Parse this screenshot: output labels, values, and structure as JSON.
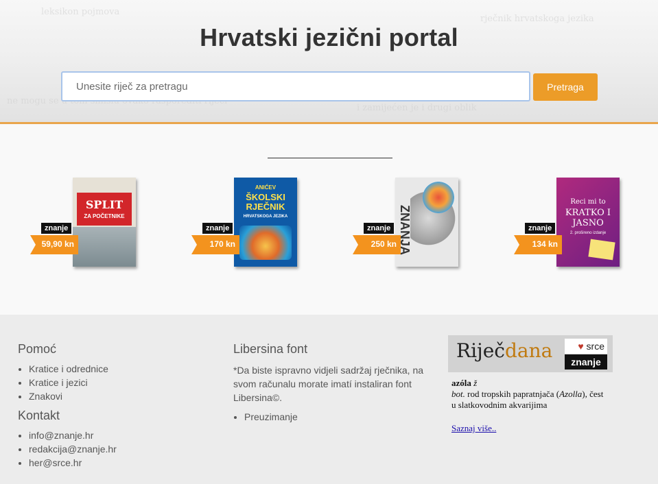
{
  "header": {
    "title": "Hrvatski jezični portal",
    "search_placeholder": "Unesite riječ za pretragu",
    "search_button": "Pretraga"
  },
  "books": [
    {
      "badge": "znanje",
      "price": "59,90 kn",
      "cover_lines": [
        "SPLIT",
        "ZA POČETNIKE"
      ],
      "cover_color": "#e6e1d6"
    },
    {
      "badge": "znanje",
      "price": "170 kn",
      "cover_lines": [
        "ANIĆEV",
        "ŠKOLSKI RJEČNIK",
        "HRVATSKOGA JEZIKA"
      ],
      "cover_color": "#0f5aa6"
    },
    {
      "badge": "znanje",
      "price": "250 kn",
      "cover_lines": [
        "ZNANJA"
      ],
      "cover_color": "#e8e8e8"
    },
    {
      "badge": "znanje",
      "price": "134 kn",
      "cover_lines": [
        "Reci mi to",
        "KRATKO I JASNO",
        "2. prošireno izdanje"
      ],
      "cover_color": "#8a1f80"
    }
  ],
  "footer": {
    "help_heading": "Pomoć",
    "help_items": [
      "Kratice i odrednice",
      "Kratice i jezici",
      "Znakovi"
    ],
    "contact_heading": "Kontakt",
    "contact_items": [
      "info@znanje.hr",
      "redakcija@znanje.hr",
      "her@srce.hr"
    ],
    "font_heading": "Libersina font",
    "font_text": "*Da biste ispravno vidjeli sadržaj rječnika, na svom računalu morate imatí instaliran font Libersina©.",
    "font_items": [
      "Preuzimanje"
    ],
    "word_of_day": {
      "banner_word": "Riječ",
      "banner_word2": "dana",
      "srce": "srce",
      "znanje": "znanje",
      "headword": "azóla",
      "gender": "ž",
      "field": "bot.",
      "definition_part1": "rod tropskih papratnjača (",
      "latin": "Azolla",
      "definition_part2": "), čest u slatkovodnim akvarijima",
      "more_link": "Saznaj više.."
    }
  }
}
